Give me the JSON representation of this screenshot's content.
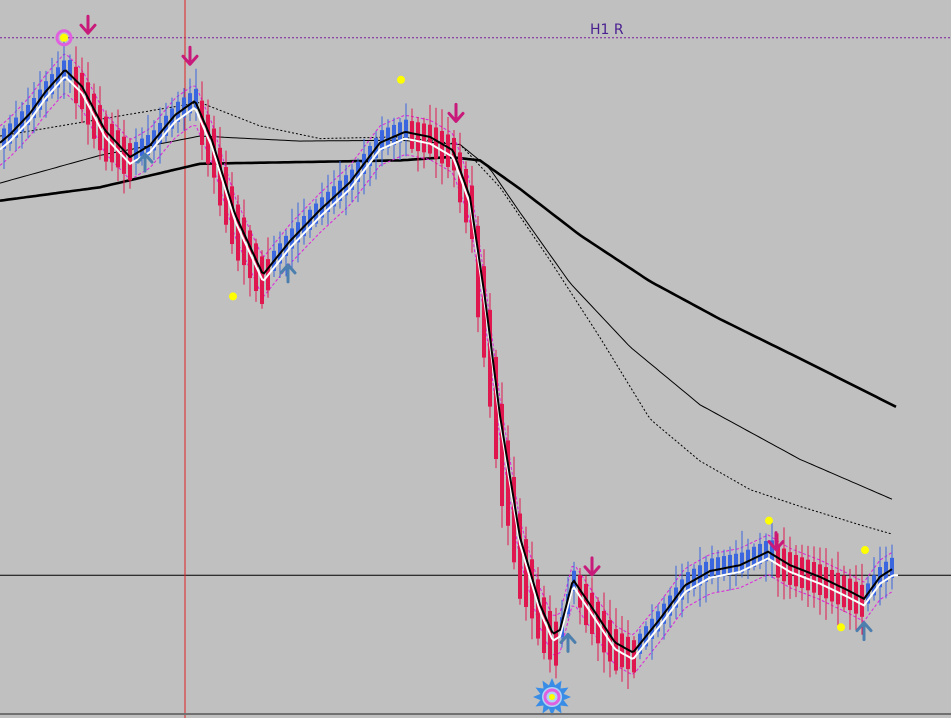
{
  "chart_data": {
    "type": "candlestick",
    "title": "",
    "xlabel": "",
    "ylabel": "",
    "grid": false,
    "annotation_text": "H1 R",
    "colors": {
      "background": "#c0c0c0",
      "bull": "#3a66e0",
      "bear": "#e0174f",
      "signal_fast": "#000000",
      "signal_fast_shadow": "#ffffff",
      "envelope": "#dd22dd",
      "ma": "#000000",
      "marker_dot": "#ffff00",
      "arrow_up": "#4d7fae",
      "arrow_down": "#c81a7a",
      "crosshair_vertical": "#e02020",
      "level_dashed": "#7a1fa0",
      "level_solid": "#000000",
      "annotation_text": "#4a2090"
    },
    "key_points": [
      [
        0,
        0.95
      ],
      [
        10,
        1.05
      ],
      [
        30,
        1.3
      ],
      [
        45,
        1.55
      ],
      [
        65,
        1.82
      ],
      [
        82,
        1.62
      ],
      [
        105,
        1.1
      ],
      [
        130,
        0.78
      ],
      [
        150,
        0.92
      ],
      [
        175,
        1.28
      ],
      [
        195,
        1.45
      ],
      [
        212,
        0.98
      ],
      [
        235,
        0.1
      ],
      [
        263,
        -0.62
      ],
      [
        290,
        -0.22
      ],
      [
        320,
        0.15
      ],
      [
        350,
        0.48
      ],
      [
        380,
        0.95
      ],
      [
        405,
        1.08
      ],
      [
        430,
        1.02
      ],
      [
        453,
        0.86
      ],
      [
        470,
        0.3
      ],
      [
        485,
        -0.9
      ],
      [
        500,
        -2.3
      ],
      [
        520,
        -3.75
      ],
      [
        540,
        -4.55
      ],
      [
        553,
        -4.9
      ],
      [
        560,
        -4.85
      ],
      [
        573,
        -4.25
      ],
      [
        590,
        -4.55
      ],
      [
        615,
        -5.0
      ],
      [
        633,
        -5.12
      ],
      [
        660,
        -4.72
      ],
      [
        685,
        -4.32
      ],
      [
        710,
        -4.15
      ],
      [
        740,
        -4.08
      ],
      [
        768,
        -3.92
      ],
      [
        790,
        -4.08
      ],
      [
        820,
        -4.22
      ],
      [
        848,
        -4.38
      ],
      [
        864,
        -4.48
      ],
      [
        880,
        -4.22
      ],
      [
        893,
        -4.12
      ]
    ],
    "ma_slow": [
      [
        0,
        0.26
      ],
      [
        100,
        0.42
      ],
      [
        200,
        0.7
      ],
      [
        300,
        0.72
      ],
      [
        400,
        0.74
      ],
      [
        450,
        0.78
      ],
      [
        480,
        0.74
      ],
      [
        520,
        0.4
      ],
      [
        580,
        -0.15
      ],
      [
        650,
        -0.7
      ],
      [
        720,
        -1.15
      ],
      [
        800,
        -1.62
      ],
      [
        897,
        -2.2
      ]
    ],
    "ma_mid": [
      [
        0,
        0.47
      ],
      [
        100,
        0.8
      ],
      [
        200,
        1.03
      ],
      [
        300,
        0.97
      ],
      [
        400,
        0.98
      ],
      [
        460,
        0.93
      ],
      [
        490,
        0.64
      ],
      [
        520,
        0.12
      ],
      [
        570,
        -0.72
      ],
      [
        630,
        -1.48
      ],
      [
        700,
        -2.17
      ],
      [
        800,
        -2.82
      ],
      [
        895,
        -3.31
      ]
    ],
    "ma_fast_dotted": [
      [
        0,
        1.03
      ],
      [
        100,
        1.23
      ],
      [
        200,
        1.43
      ],
      [
        260,
        1.15
      ],
      [
        320,
        1.0
      ],
      [
        400,
        1.02
      ],
      [
        460,
        0.93
      ],
      [
        500,
        0.42
      ],
      [
        550,
        -0.45
      ],
      [
        600,
        -1.37
      ],
      [
        650,
        -2.34
      ],
      [
        700,
        -2.84
      ],
      [
        750,
        -3.18
      ],
      [
        800,
        -3.38
      ],
      [
        860,
        -3.6
      ],
      [
        895,
        -3.72
      ]
    ],
    "yellow_dots": [
      {
        "x": 64,
        "y": 2.2
      },
      {
        "x": 233,
        "y": -0.88
      },
      {
        "x": 401,
        "y": 1.7
      },
      {
        "x": 769,
        "y": -3.55
      },
      {
        "x": 865,
        "y": -3.9
      },
      {
        "x": 841,
        "y": -4.82
      }
    ],
    "up_arrows": [
      {
        "x": 145,
        "y": 0.72
      },
      {
        "x": 288,
        "y": -0.6
      },
      {
        "x": 568,
        "y": -5.0
      },
      {
        "x": 864,
        "y": -4.86
      }
    ],
    "down_arrows": [
      {
        "x": 88,
        "y": 2.35
      },
      {
        "x": 190,
        "y": 1.98
      },
      {
        "x": 456,
        "y": 1.3
      },
      {
        "x": 592,
        "y": -4.1
      },
      {
        "x": 776,
        "y": -3.8
      }
    ],
    "circle_marker": {
      "x": 64,
      "y": 2.2
    },
    "sun_marker": {
      "x": 552,
      "y": -5.65
    },
    "level_dashed_y": 2.2,
    "level_solid_y": -4.2,
    "vertical_line_x": 185,
    "ylim": [
      -5.9,
      2.65
    ],
    "x_range": [
      0,
      951
    ]
  }
}
